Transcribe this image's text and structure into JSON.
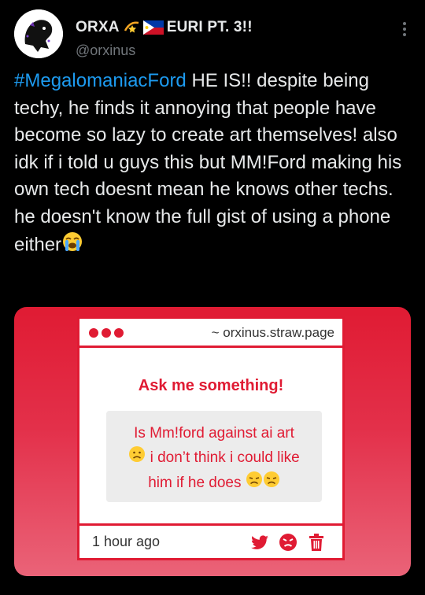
{
  "author": {
    "display_name_start": "ORXA",
    "display_name_end": "EURI PT. 3!!",
    "handle": "@orxinus"
  },
  "tweet": {
    "hashtag": "#MegalomaniacFord",
    "body": " HE IS!! despite being techy, he finds it annoying that people have become so lazy to create art themselves! also idk if i told u guys this but MM!Ford making his own tech doesnt mean he knows other techs. he doesn't know the full gist of using a phone either"
  },
  "card": {
    "url": "~ orxinus.straw.page",
    "prompt": "Ask me something!",
    "question_line1": "Is Mm!ford against ai art",
    "question_line2": " i don’t think i could like",
    "question_line3": "him if he does ",
    "time": "1 hour ago"
  },
  "colors": {
    "accent": "#e01b33",
    "hashtag": "#1d9bf0",
    "muted": "#71767b"
  },
  "icons": [
    "dizzy-icon",
    "philippines-flag-icon",
    "more-icon",
    "loudly-crying-face-icon",
    "slightly-frowning-face-icon",
    "disappointed-face-icon",
    "twitter-bird-icon",
    "angry-face-icon",
    "trash-icon"
  ]
}
